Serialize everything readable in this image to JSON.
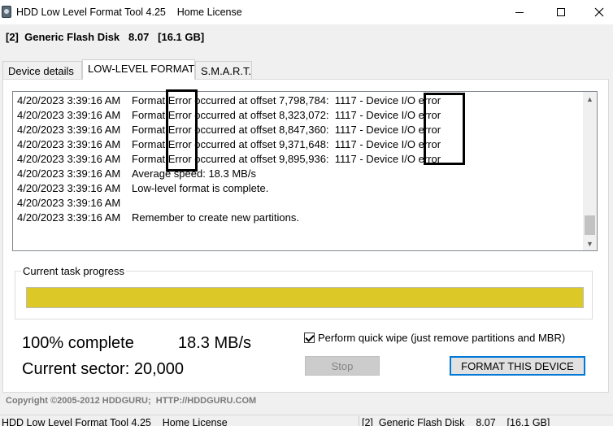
{
  "window": {
    "title": "HDD Low Level Format Tool 4.25    Home License",
    "min_icon": "minimize-icon",
    "max_icon": "maximize-icon",
    "close_icon": "close-icon"
  },
  "device": {
    "line": "[2]  Generic Flash Disk   8.07   [16.1 GB]"
  },
  "tabs": [
    {
      "label": "Device details",
      "active": false
    },
    {
      "label": "LOW-LEVEL FORMAT",
      "active": true
    },
    {
      "label": "S.M.A.R.T.",
      "active": false
    }
  ],
  "log": {
    "lines": [
      {
        "time": "4/20/2023 3:39:16 AM",
        "message": "Format Error occurred at offset 7,798,784:  1117 - Device I/O error"
      },
      {
        "time": "4/20/2023 3:39:16 AM",
        "message": "Format Error occurred at offset 8,323,072:  1117 - Device I/O error"
      },
      {
        "time": "4/20/2023 3:39:16 AM",
        "message": "Format Error occurred at offset 8,847,360:  1117 - Device I/O error"
      },
      {
        "time": "4/20/2023 3:39:16 AM",
        "message": "Format Error occurred at offset 9,371,648:  1117 - Device I/O error"
      },
      {
        "time": "4/20/2023 3:39:16 AM",
        "message": "Format Error occurred at offset 9,895,936:  1117 - Device I/O error"
      },
      {
        "time": "4/20/2023 3:39:16 AM",
        "message": "Average speed: 18.3 MB/s"
      },
      {
        "time": "4/20/2023 3:39:16 AM",
        "message": "Low-level format is complete."
      },
      {
        "time": "4/20/2023 3:39:16 AM",
        "message": ""
      },
      {
        "time": "4/20/2023 3:39:16 AM",
        "message": "Remember to create new partitions."
      }
    ]
  },
  "progress": {
    "group_label": "Current task progress",
    "fraction": 1.0,
    "fill_color": "#dcc928"
  },
  "stats": {
    "percent_text": "100% complete",
    "speed_text": "18.3 MB/s",
    "sector_text": "Current sector: 20,000"
  },
  "options": {
    "quick_wipe_label": "Perform quick wipe (just remove partitions and MBR)",
    "quick_wipe_checked": true
  },
  "buttons": {
    "stop": "Stop",
    "format": "FORMAT THIS DEVICE"
  },
  "footer": {
    "copyright": "Copyright ©2005-2012 HDDGURU;  HTTP://HDDGURU.COM"
  },
  "statusbar": {
    "left": "HDD Low Level Format Tool 4.25    Home License",
    "right": "[2]  Generic Flash Disk    8.07    [16.1 GB]"
  },
  "colors": {
    "accent": "#0078d7",
    "progress": "#dcc928"
  }
}
